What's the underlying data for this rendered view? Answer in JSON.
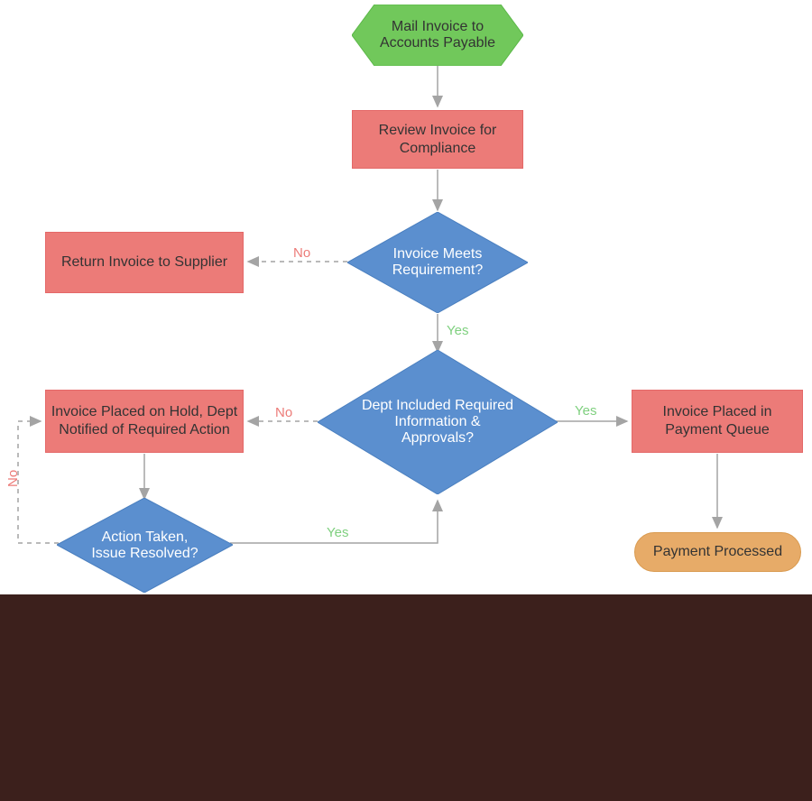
{
  "nodes": {
    "start": {
      "text": "Mail Invoice to Accounts Payable"
    },
    "review": {
      "text": "Review Invoice for Compliance"
    },
    "d1": {
      "text": "Invoice Meets Requirement?"
    },
    "return": {
      "text": "Return Invoice to Supplier"
    },
    "d2": {
      "text": "Dept Included Required Information & Approvals?"
    },
    "hold": {
      "text": "Invoice Placed on Hold, Dept Notified of Required Action"
    },
    "queue": {
      "text": "Invoice Placed in Payment Queue"
    },
    "d3": {
      "text": "Action Taken, Issue Resolved?"
    },
    "processed": {
      "text": "Payment Processed"
    }
  },
  "labels": {
    "d1_no": "No",
    "d1_yes": "Yes",
    "d2_no": "No",
    "d2_yes": "Yes",
    "d3_yes": "Yes",
    "d3_no": "No"
  },
  "colors": {
    "start": "#71c85b",
    "process": "#ec7b78",
    "decision": "#5b8fcf",
    "terminator": "#e7ab68",
    "arrow": "#a4a4a4"
  }
}
